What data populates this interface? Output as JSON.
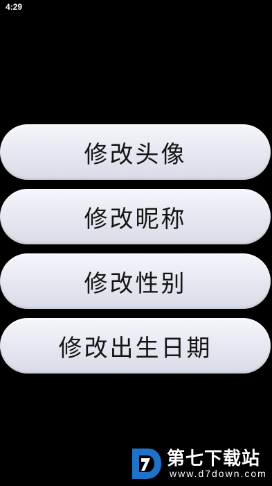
{
  "status_bar": {
    "time": "4:29"
  },
  "menu": {
    "items": [
      {
        "label": "修改头像"
      },
      {
        "label": "修改昵称"
      },
      {
        "label": "修改性别"
      },
      {
        "label": "修改出生日期"
      }
    ]
  },
  "watermark": {
    "logo_letter": "D",
    "title": "第七下载站",
    "url": "www.d7down.com",
    "accent_color": "#1e73c8"
  }
}
